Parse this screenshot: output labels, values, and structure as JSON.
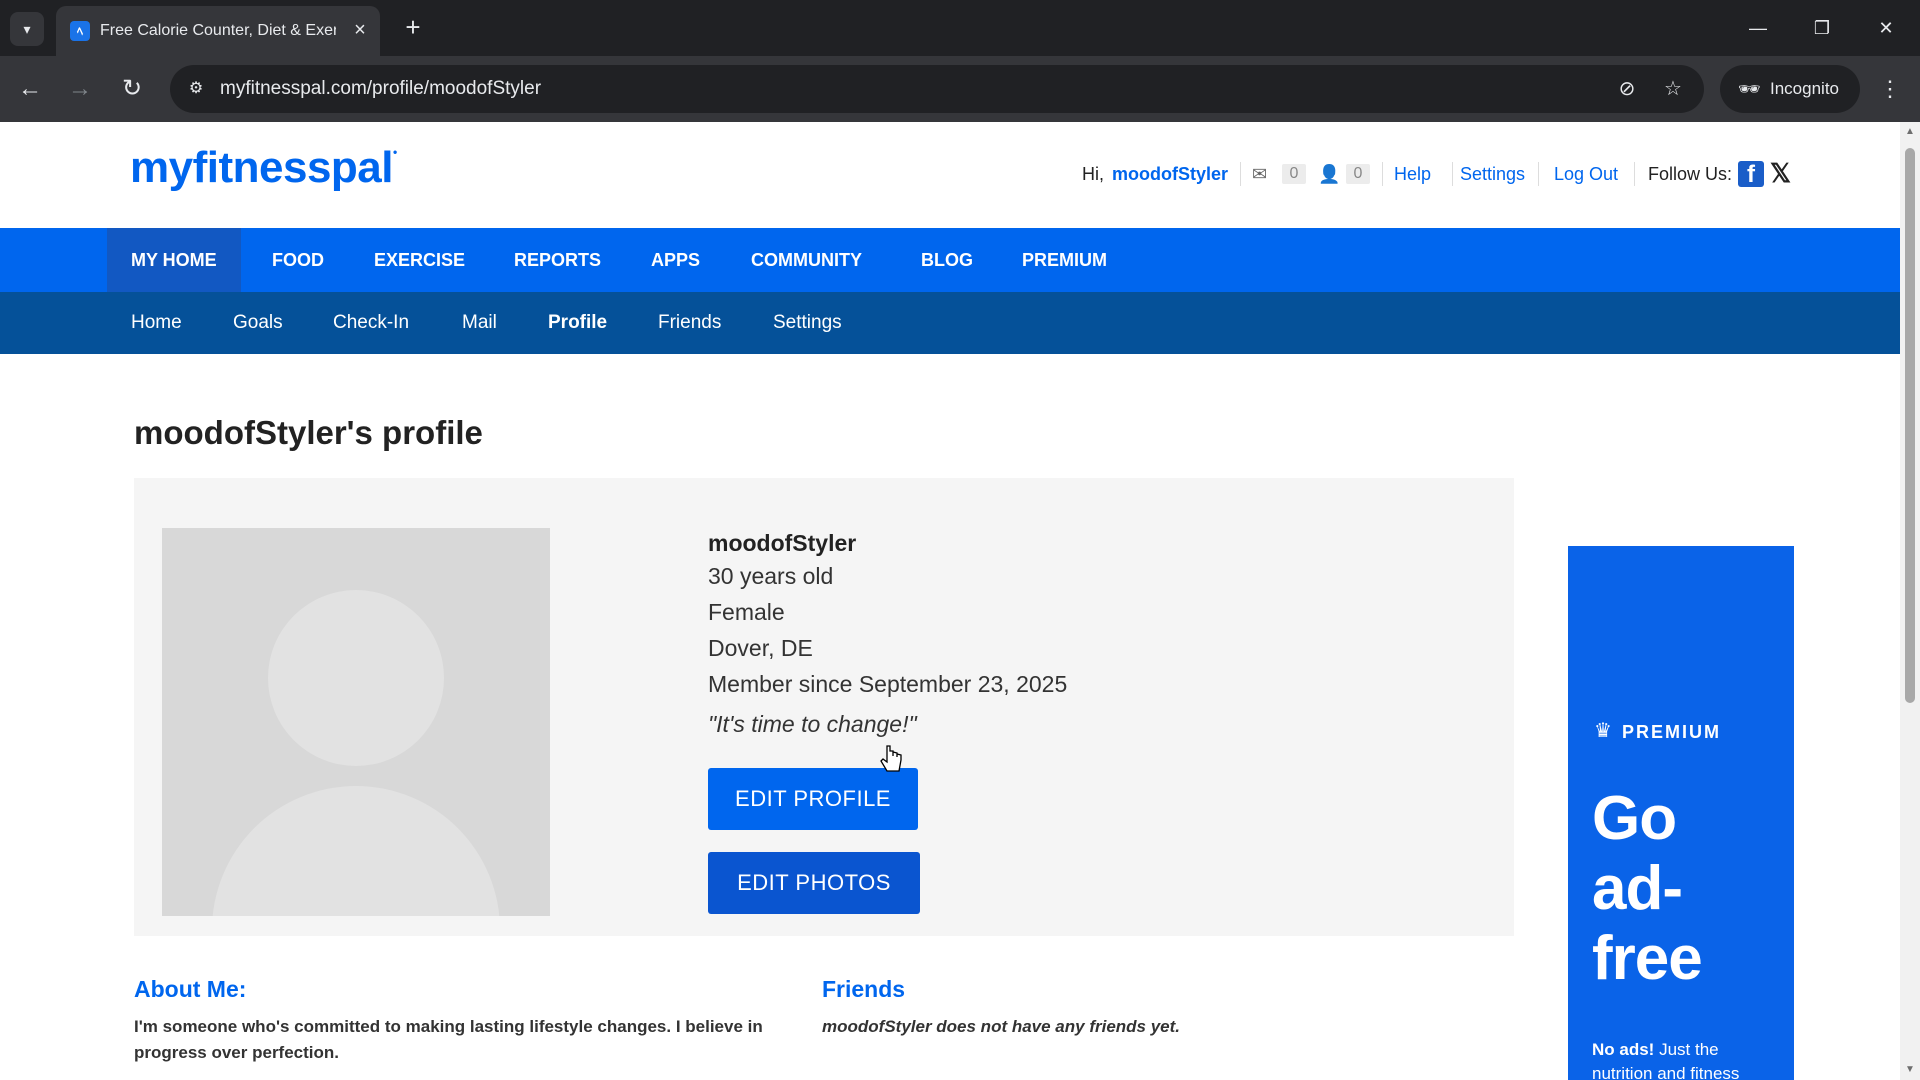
{
  "browser": {
    "tab_title": "Free Calorie Counter, Diet & Exercise",
    "url": "myfitnesspal.com/profile/moodofStyler",
    "incognito_label": "Incognito",
    "icons": [
      "chevron-down-icon",
      "close-icon",
      "plus-icon",
      "minimize-icon",
      "restore-icon",
      "back-icon",
      "forward-icon",
      "reload-icon",
      "site-info-icon",
      "eye-off-icon",
      "star-icon",
      "incognito-icon",
      "menu-icon"
    ]
  },
  "header": {
    "logo": "myfitnesspal",
    "greeting": "Hi,",
    "username": "moodofStyler",
    "mail_count": "0",
    "friend_request_count": "0",
    "help": "Help",
    "settings": "Settings",
    "logout": "Log Out",
    "follow_us": "Follow Us:"
  },
  "main_nav": [
    "MY HOME",
    "FOOD",
    "EXERCISE",
    "REPORTS",
    "APPS",
    "COMMUNITY",
    "BLOG",
    "PREMIUM"
  ],
  "sub_nav": [
    "Home",
    "Goals",
    "Check-In",
    "Mail",
    "Profile",
    "Friends",
    "Settings"
  ],
  "profile": {
    "title": "moodofStyler's profile",
    "name": "moodofStyler",
    "age": "30 years old",
    "gender": "Female",
    "location": "Dover, DE",
    "member_since": "Member since September 23, 2025",
    "quote": "\"It's time to change!\"",
    "edit_profile": "EDIT PROFILE",
    "edit_photos": "EDIT PHOTOS"
  },
  "about": {
    "title": "About Me:",
    "text": "I'm someone who's committed to making lasting lifestyle changes. I believe in progress over perfection."
  },
  "friends": {
    "title": "Friends",
    "text": "moodofStyler does not have any friends yet."
  },
  "ad": {
    "premium_label": "PREMIUM",
    "headline": "Go ad-free",
    "sub_bold": "No ads!",
    "sub_rest": "Just the nutrition and fitness"
  },
  "colors": {
    "brand_blue": "#0066ee",
    "subnav_blue": "#055199",
    "ad_blue": "#0a63e8"
  }
}
